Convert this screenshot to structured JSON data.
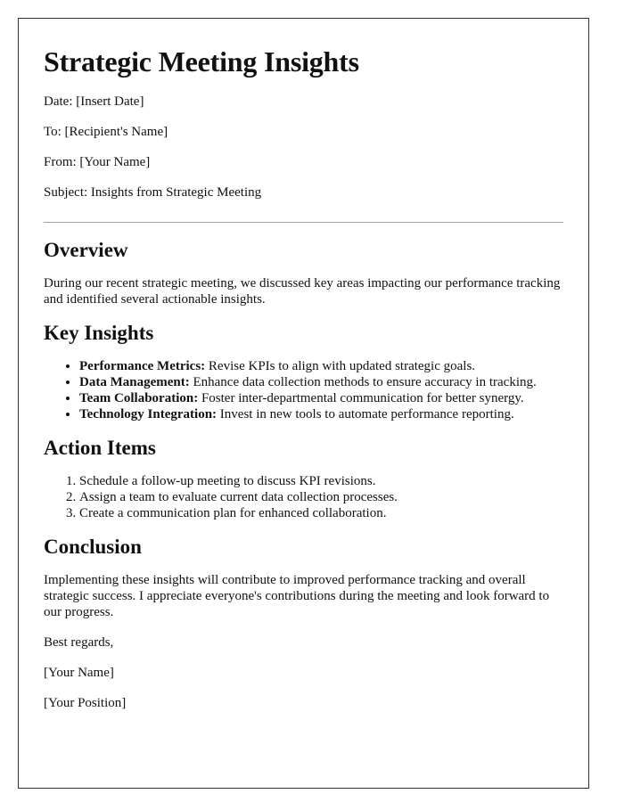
{
  "title": "Strategic Meeting Insights",
  "meta": {
    "date": "Date: [Insert Date]",
    "to": "To: [Recipient's Name]",
    "from": "From: [Your Name]",
    "subject": "Subject: Insights from Strategic Meeting"
  },
  "overview": {
    "heading": "Overview",
    "text": "During our recent strategic meeting, we discussed key areas impacting our performance tracking and identified several actionable insights."
  },
  "key_insights": {
    "heading": "Key Insights",
    "items": [
      {
        "label": "Performance Metrics:",
        "text": " Revise KPIs to align with updated strategic goals."
      },
      {
        "label": "Data Management:",
        "text": " Enhance data collection methods to ensure accuracy in tracking."
      },
      {
        "label": "Team Collaboration:",
        "text": " Foster inter-departmental communication for better synergy."
      },
      {
        "label": "Technology Integration:",
        "text": " Invest in new tools to automate performance reporting."
      }
    ]
  },
  "action_items": {
    "heading": "Action Items",
    "items": [
      "Schedule a follow-up meeting to discuss KPI revisions.",
      "Assign a team to evaluate current data collection processes.",
      "Create a communication plan for enhanced collaboration."
    ]
  },
  "conclusion": {
    "heading": "Conclusion",
    "text": "Implementing these insights will contribute to improved performance tracking and overall strategic success. I appreciate everyone's contributions during the meeting and look forward to our progress."
  },
  "signature": {
    "closing": "Best regards,",
    "name": "[Your Name]",
    "position": "[Your Position]"
  }
}
